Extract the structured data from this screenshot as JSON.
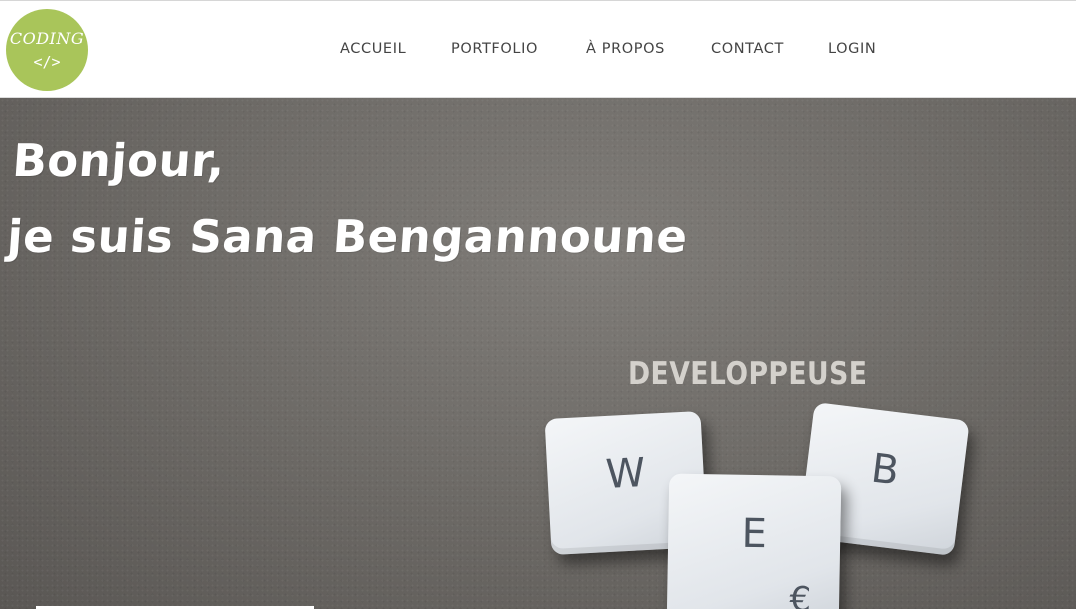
{
  "logo": {
    "text": "CODING",
    "code": "</>",
    "color": "#a9c55a"
  },
  "nav": {
    "items": [
      {
        "label": "ACCUEIL"
      },
      {
        "label": "PORTFOLIO"
      },
      {
        "label": "À PROPOS"
      },
      {
        "label": "CONTACT"
      },
      {
        "label": "LOGIN"
      }
    ]
  },
  "hero": {
    "greeting": "Bonjour,",
    "intro": "je suis Sana Bengannoune",
    "subtitle": "DEVELOPPEUSE",
    "tiles": [
      {
        "letter": "W"
      },
      {
        "letter": "B"
      },
      {
        "letter": "E",
        "sub": "€"
      }
    ]
  }
}
